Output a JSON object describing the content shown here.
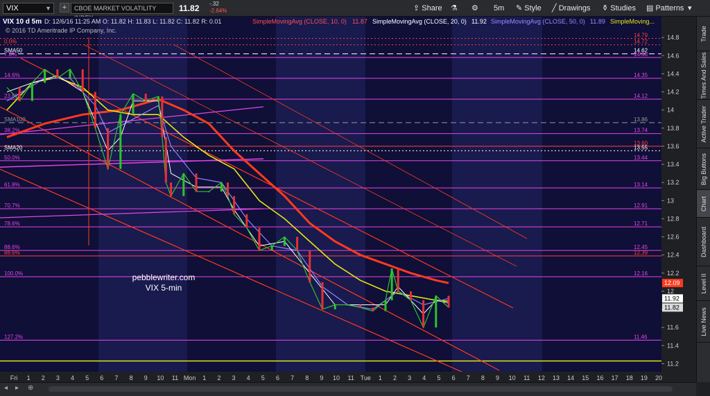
{
  "toolbar": {
    "symbol": "VIX",
    "description": "CBOE MARKET VOLATILITY INDEX",
    "last": "11.82",
    "net_change": "-.32",
    "pct_change": "-2.64%",
    "share_label": "Share",
    "timeframe": "5m",
    "style_label": "Style",
    "drawings_label": "Drawings",
    "studies_label": "Studies",
    "patterns_label": "Patterns"
  },
  "sidebar_tabs": [
    "Trade",
    "Times And Sales",
    "Active Trader",
    "Big Buttons",
    "Chart",
    "Dashboard",
    "Level II",
    "Live News"
  ],
  "chart_header": {
    "ticker_line": "VIX 10 d 5m",
    "copyright": "© 2016 TD Ameritrade IP Company, Inc.",
    "ohlc": "D: 12/6/16 11:25 AM   O: 11.82   H: 11.83   L: 11.82   C: 11.82   R: 0.01",
    "sma10_label": "SimpleMovingAvg (CLOSE, 10, 0)",
    "sma10_value": "11.87",
    "sma20_label": "SimpleMovingAvg (CLOSE, 20, 0)",
    "sma20_value": "11.92",
    "sma50_label": "SimpleMovingAvg (CLOSE, 50, 0)",
    "sma50_value": "11.89",
    "sma_extra_label": "SimpleMoving..."
  },
  "annotation": {
    "line1": "pebblewriter.com",
    "line2": "VIX 5-min"
  },
  "colors": {
    "background": "#0f0f38",
    "band": "#191a4e",
    "magenta": "#e645e6",
    "red": "#ff3b1e",
    "yellow": "#e6e614",
    "white": "#ffffff",
    "violet": "#8f82ff",
    "up_candle": "#2ec22e",
    "down_candle": "#e63232"
  },
  "chart_data": {
    "type": "line",
    "y_range": [
      11.05,
      15.0
    ],
    "y_ticks": [
      11.2,
      11.4,
      11.6,
      11.8,
      12,
      12.2,
      12.4,
      12.6,
      12.8,
      13,
      13.2,
      13.4,
      13.6,
      13.8,
      14,
      14.2,
      14.4,
      14.6,
      14.8
    ],
    "x_labels": [
      "Fri",
      "1",
      "2",
      "3",
      "4",
      "5",
      "6",
      "7",
      "8",
      "9",
      "10",
      "11",
      "Mon",
      "1",
      "2",
      "3",
      "4",
      "5",
      "6",
      "7",
      "8",
      "9",
      "10",
      "11",
      "Tue",
      "1",
      "2",
      "3",
      "4",
      "5",
      "6",
      "7",
      "8",
      "9",
      "10",
      "11",
      "12",
      "13",
      "14",
      "15",
      "16",
      "17",
      "18",
      "19",
      "20"
    ],
    "levels": [
      {
        "label": "0.0%",
        "value": 14.72,
        "tag": "14.72",
        "color": "#ff4040",
        "dash": "dot"
      },
      {
        "label": "",
        "value": 14.79,
        "tag": "14.79",
        "color": "#ff4040",
        "dash": "dot"
      },
      {
        "label": "SMA50",
        "value": 14.62,
        "tag": "14.62",
        "color": "#ffffff",
        "dash": "dash"
      },
      {
        "label": "7.0%",
        "value": 14.58,
        "tag": "14.58",
        "color": "#e645e6",
        "dash": "solid"
      },
      {
        "label": "14.6%",
        "value": 14.35,
        "tag": "14.35",
        "color": "#e645e6",
        "dash": "solid"
      },
      {
        "label": "23.6%",
        "value": 14.12,
        "tag": "14.12",
        "color": "#e645e6",
        "dash": "solid"
      },
      {
        "label": "SMA100",
        "value": 13.86,
        "tag": "13.86",
        "color": "#9a9a9a",
        "dash": "dash"
      },
      {
        "label": "38.2%",
        "value": 13.74,
        "tag": "13.74",
        "color": "#e645e6",
        "dash": "solid"
      },
      {
        "label": "",
        "value": 13.6,
        "tag": "13.60",
        "color": "#ff4040",
        "dash": "solid"
      },
      {
        "label": "SMA20",
        "value": 13.55,
        "tag": "13.55",
        "color": "#ffffff",
        "dash": "dot"
      },
      {
        "label": "50.0%",
        "value": 13.44,
        "tag": "13.44",
        "color": "#e645e6",
        "dash": "solid"
      },
      {
        "label": "61.8%",
        "value": 13.14,
        "tag": "13.14",
        "color": "#e645e6",
        "dash": "solid"
      },
      {
        "label": "70.7%",
        "value": 12.91,
        "tag": "12.91",
        "color": "#e645e6",
        "dash": "solid"
      },
      {
        "label": "78.6%",
        "value": 12.71,
        "tag": "12.71",
        "color": "#e645e6",
        "dash": "solid"
      },
      {
        "label": "88.6%",
        "value": 12.45,
        "tag": "12.45",
        "color": "#e645e6",
        "dash": "solid"
      },
      {
        "label": "88.6%",
        "value": 12.39,
        "tag": "12.39",
        "color": "#ff4040",
        "dash": "solid"
      },
      {
        "label": "100.0%",
        "value": 12.16,
        "tag": "12.16",
        "color": "#e645e6",
        "dash": "solid"
      },
      {
        "label": "127.2%",
        "value": 11.46,
        "tag": "11.46",
        "color": "#e645e6",
        "dash": "solid"
      }
    ],
    "yellow_hline": 11.23,
    "price_tags": [
      {
        "value": 12.09,
        "tag": "12.09",
        "bg": "#ff3b1e",
        "fg": "#ffffff"
      },
      {
        "value": 11.92,
        "tag": "11.92",
        "bg": "#ffffff",
        "fg": "#000000"
      },
      {
        "value": 11.82,
        "tag": "11.82",
        "bg": "#dcdcdc",
        "fg": "#000000"
      }
    ],
    "series": [
      {
        "name": "Price",
        "color": "#2ec22e",
        "points": [
          [
            0,
            14.25
          ],
          [
            1,
            14.1
          ],
          [
            2,
            14.3
          ],
          [
            3,
            14.45
          ],
          [
            4,
            14.35
          ],
          [
            5,
            14.45
          ],
          [
            6,
            14.2
          ],
          [
            7,
            13.8
          ],
          [
            8,
            13.35
          ],
          [
            9,
            13.95
          ],
          [
            10,
            14.18
          ],
          [
            11,
            14.1
          ],
          [
            12,
            14.15
          ],
          [
            12.3,
            13.7
          ],
          [
            12.6,
            13.2
          ],
          [
            13,
            13.05
          ],
          [
            14,
            13.3
          ],
          [
            15,
            13.1
          ],
          [
            16,
            13.1
          ],
          [
            17,
            13.2
          ],
          [
            17.5,
            13.05
          ],
          [
            18,
            12.85
          ],
          [
            19,
            12.7
          ],
          [
            20,
            12.45
          ],
          [
            21,
            12.5
          ],
          [
            22,
            12.6
          ],
          [
            23,
            12.45
          ],
          [
            24,
            12.1
          ],
          [
            25,
            11.8
          ],
          [
            26,
            11.85
          ],
          [
            27,
            11.85
          ],
          [
            28,
            11.82
          ],
          [
            29,
            11.78
          ],
          [
            30,
            11.9
          ],
          [
            30.5,
            12.25
          ],
          [
            31,
            12.0
          ],
          [
            32,
            11.9
          ],
          [
            33,
            11.6
          ],
          [
            34,
            11.95
          ],
          [
            35,
            11.82
          ]
        ]
      },
      {
        "name": "SMA10",
        "color": "#ffffff",
        "points": [
          [
            0,
            14.2
          ],
          [
            2,
            14.3
          ],
          [
            4,
            14.38
          ],
          [
            6,
            14.2
          ],
          [
            8,
            13.55
          ],
          [
            9,
            13.7
          ],
          [
            10,
            14.1
          ],
          [
            12,
            14.1
          ],
          [
            13,
            13.3
          ],
          [
            15,
            13.15
          ],
          [
            17,
            13.15
          ],
          [
            18,
            12.9
          ],
          [
            20,
            12.5
          ],
          [
            22,
            12.55
          ],
          [
            24,
            12.2
          ],
          [
            26,
            11.85
          ],
          [
            28,
            11.85
          ],
          [
            30,
            11.85
          ],
          [
            31,
            12.05
          ],
          [
            33,
            11.75
          ],
          [
            34,
            11.9
          ],
          [
            35,
            11.87
          ]
        ]
      },
      {
        "name": "SMA20",
        "color": "#8f82ff",
        "points": [
          [
            0,
            14.1
          ],
          [
            3,
            14.35
          ],
          [
            5,
            14.35
          ],
          [
            7,
            14.05
          ],
          [
            8,
            13.75
          ],
          [
            10,
            13.9
          ],
          [
            12,
            14.05
          ],
          [
            13,
            13.6
          ],
          [
            15,
            13.25
          ],
          [
            17,
            13.2
          ],
          [
            19,
            12.8
          ],
          [
            21,
            12.5
          ],
          [
            23,
            12.45
          ],
          [
            25,
            12.05
          ],
          [
            27,
            11.85
          ],
          [
            29,
            11.8
          ],
          [
            31,
            12.0
          ],
          [
            33,
            11.85
          ],
          [
            35,
            11.92
          ]
        ]
      },
      {
        "name": "SMA50",
        "color": "#e6e614",
        "points": [
          [
            0,
            14.0
          ],
          [
            2,
            14.3
          ],
          [
            4,
            14.36
          ],
          [
            6,
            14.25
          ],
          [
            8,
            14.0
          ],
          [
            10,
            13.95
          ],
          [
            12,
            13.95
          ],
          [
            14,
            13.7
          ],
          [
            16,
            13.5
          ],
          [
            18,
            13.35
          ],
          [
            20,
            13.0
          ],
          [
            22,
            12.8
          ],
          [
            24,
            12.55
          ],
          [
            26,
            12.3
          ],
          [
            28,
            12.12
          ],
          [
            30,
            12.0
          ],
          [
            32,
            11.95
          ],
          [
            34,
            11.9
          ],
          [
            35,
            11.89
          ]
        ]
      },
      {
        "name": "SMA100",
        "color": "#ff3b1e",
        "points": [
          [
            0,
            13.7
          ],
          [
            3,
            13.85
          ],
          [
            6,
            13.95
          ],
          [
            9,
            14.0
          ],
          [
            12,
            14.12
          ],
          [
            14,
            14.0
          ],
          [
            16,
            13.85
          ],
          [
            18,
            13.55
          ],
          [
            20,
            13.3
          ],
          [
            22,
            13.05
          ],
          [
            24,
            12.75
          ],
          [
            26,
            12.55
          ],
          [
            28,
            12.4
          ],
          [
            30,
            12.3
          ],
          [
            32,
            12.2
          ],
          [
            34,
            12.12
          ],
          [
            35,
            12.09
          ]
        ]
      }
    ]
  }
}
